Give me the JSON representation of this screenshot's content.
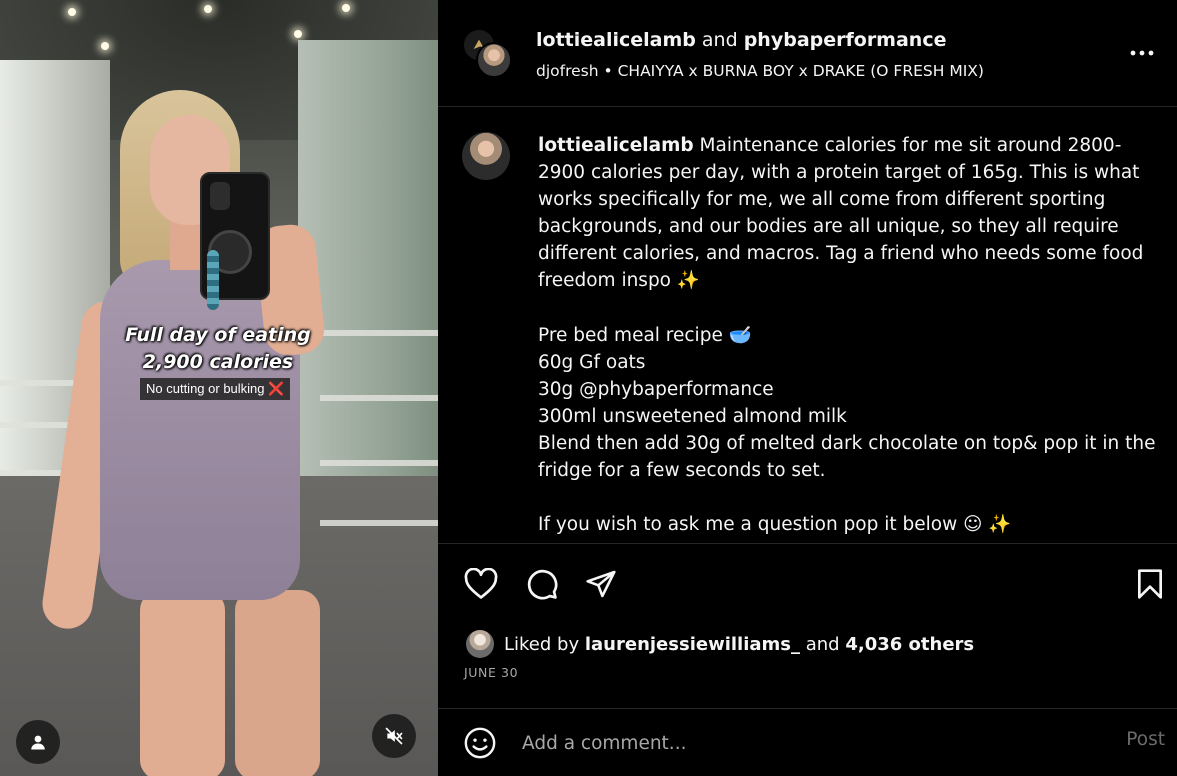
{
  "media": {
    "overlay_title_line1": "Full day of eating",
    "overlay_title_line2": "2,900 calories",
    "overlay_subtitle": "No cutting or bulking",
    "overlay_subtitle_emoji": "❌"
  },
  "header": {
    "user1": "lottiealicelamb",
    "connector": "and",
    "user2": "phybaperformance",
    "audio_artist": "djofresh",
    "audio_separator": "•",
    "audio_track": "CHAIYYA x BURNA BOY x DRAKE (O FRESH MIX)"
  },
  "caption": {
    "username": "lottiealicelamb",
    "paragraph1": "Maintenance calories for me sit around 2800-2900 calories per day, with a protein target of 165g. This is what works specifically for me, we all come from different sporting backgrounds, and our bodies are all unique, so they all require different calories, and macros. Tag a friend who needs some food freedom inspo ✨",
    "line_recipe_title": "Pre bed meal recipe 🥣",
    "line_oats": "60g Gf oats",
    "line_protein": "30g @phybaperformance",
    "line_milk": "300ml unsweetened almond milk",
    "line_blend": "Blend then add 30g of melted dark chocolate on top& pop it in the fridge for a few seconds to set.",
    "line_question": "If you wish to ask me a question pop it below ☺ ✨"
  },
  "likes": {
    "prefix": "Liked by",
    "user": "laurenjessiewilliams_",
    "connector": "and",
    "others": "4,036 others"
  },
  "date": "JUNE 30",
  "comment": {
    "placeholder": "Add a comment...",
    "post_label": "Post"
  },
  "icons": [
    "like-icon",
    "comment-icon",
    "share-icon",
    "save-icon",
    "more-icon",
    "emoji-icon",
    "user-tag-icon",
    "mute-icon"
  ]
}
